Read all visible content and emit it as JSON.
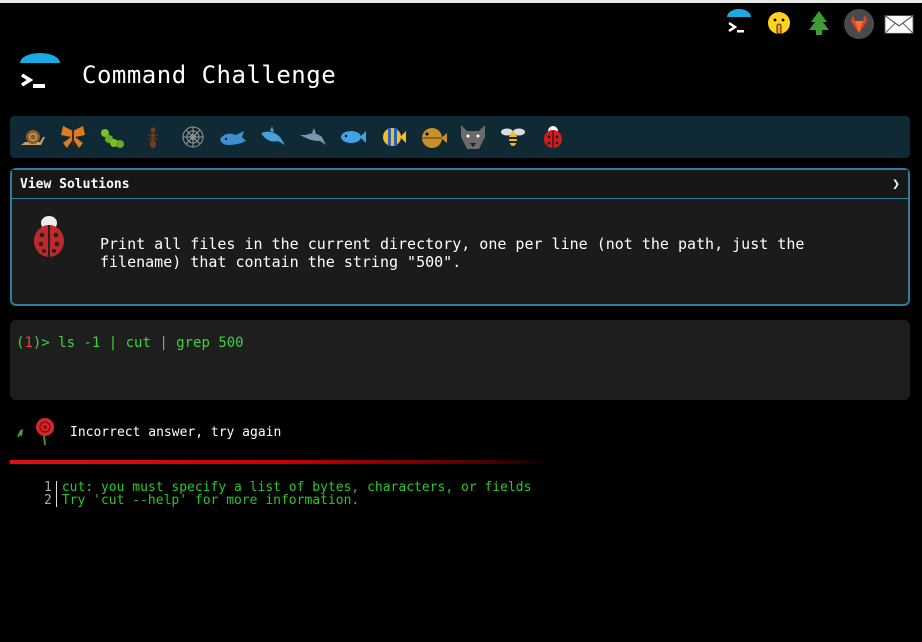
{
  "header": {
    "title": "Command Challenge"
  },
  "top_icons": [
    "terminal-icon",
    "shushing-face-icon",
    "tree-icon",
    "gitlab-icon",
    "mail-icon"
  ],
  "challenge_icons": [
    "snail-icon",
    "butterfly-icon",
    "caterpillar-icon",
    "ant-icon",
    "web-icon",
    "whale-icon",
    "shark-icon",
    "dolphin-icon",
    "fish-icon",
    "tropical-fish-icon",
    "pufferfish-icon",
    "wolf-icon",
    "bee-icon",
    "ladybug-icon"
  ],
  "solutions": {
    "label": "View Solutions",
    "chevron": "❯"
  },
  "challenge": {
    "description": "Print all files in the current directory, one per line (not the path, just the filename) that contain the string \"500\"."
  },
  "terminal": {
    "open": "(",
    "number": "1",
    "close": ")> ",
    "command": "ls -1 | cut  | grep 500"
  },
  "result": {
    "message": "Incorrect answer, try again"
  },
  "output": {
    "line_numbers": [
      "1",
      "2"
    ],
    "lines": [
      "cut: you must specify a list of bytes, characters, or fields",
      "Try 'cut --help' for more information."
    ]
  },
  "colors": {
    "accent": "#2b7ea1",
    "prompt_green": "#3fd23f",
    "error_red": "#e01010"
  }
}
